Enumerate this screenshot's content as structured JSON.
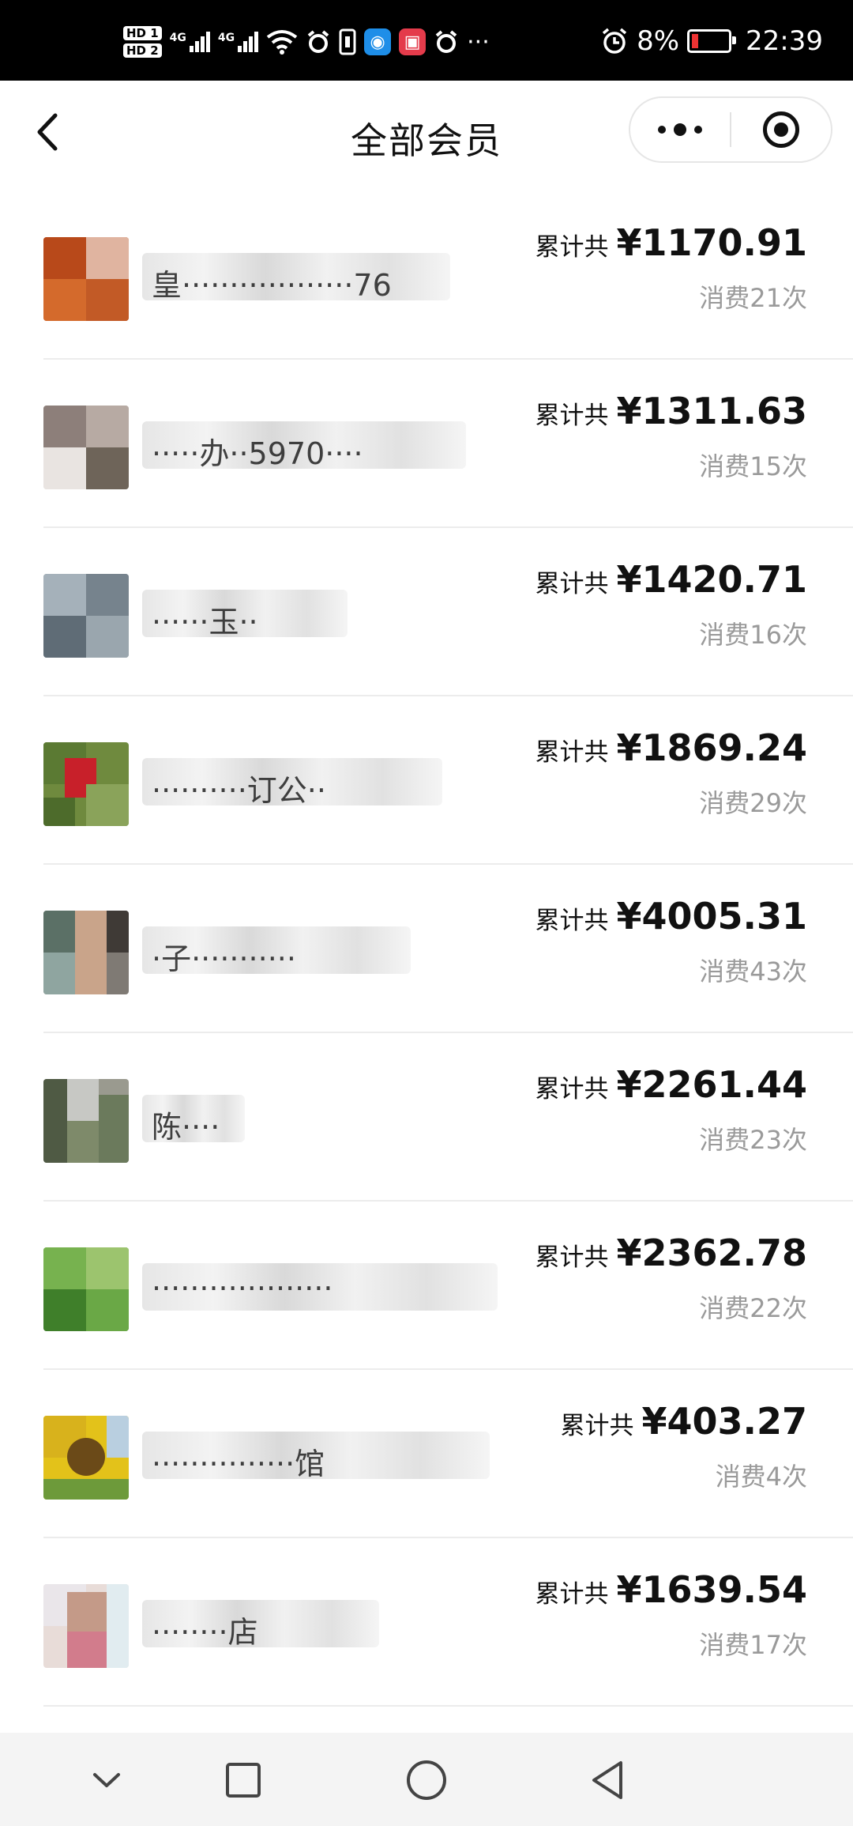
{
  "status_bar": {
    "hd1": "HD 1",
    "hd2": "HD 2",
    "net1": "4G",
    "net2": "4G",
    "more": "···",
    "battery_percent": "8%",
    "time": "22:39",
    "icons": [
      "wifi-icon",
      "alarm-app-icon",
      "sim-card-icon",
      "browser-icon",
      "reader-icon",
      "alarm-app-icon",
      "alarm-clock-icon",
      "battery-icon"
    ]
  },
  "nav": {
    "title": "全部会员",
    "back_icon": "back-arrow-icon",
    "more_icon": "more-dots-icon",
    "close_icon": "target-close-icon"
  },
  "members": [
    {
      "name": "皇··················76",
      "total_prefix": "累计共",
      "amount": "¥1170.91",
      "times": "消费21次"
    },
    {
      "name": "·····办··5970····",
      "total_prefix": "累计共",
      "amount": "¥1311.63",
      "times": "消费15次"
    },
    {
      "name": "······玉··",
      "total_prefix": "累计共",
      "amount": "¥1420.71",
      "times": "消费16次"
    },
    {
      "name": "··········订公··",
      "total_prefix": "累计共",
      "amount": "¥1869.24",
      "times": "消费29次"
    },
    {
      "name": "·子···········",
      "total_prefix": "累计共",
      "amount": "¥4005.31",
      "times": "消费43次"
    },
    {
      "name": "陈····",
      "total_prefix": "累计共",
      "amount": "¥2261.44",
      "times": "消费23次"
    },
    {
      "name": "···················",
      "total_prefix": "累计共",
      "amount": "¥2362.78",
      "times": "消费22次"
    },
    {
      "name": "···············馆",
      "total_prefix": "累计共",
      "amount": "¥403.27",
      "times": "消费4次"
    },
    {
      "name": "········店",
      "total_prefix": "累计共",
      "amount": "¥1639.54",
      "times": "消费17次"
    }
  ],
  "system_nav": {
    "icons": [
      "collapse-chevron-icon",
      "recent-apps-icon",
      "home-circle-icon",
      "back-triangle-icon"
    ]
  },
  "colors": {
    "status_bar_bg": "#000000",
    "text_primary": "#111111",
    "text_secondary": "#9a9a9a",
    "divider": "#ececec",
    "system_nav_bg": "#f4f4f4"
  }
}
